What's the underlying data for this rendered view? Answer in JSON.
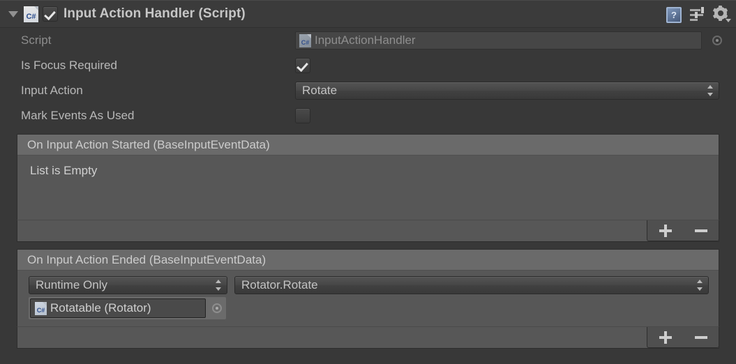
{
  "component": {
    "title": "Input Action Handler (Script)",
    "enabled": true,
    "foldout_expanded": true,
    "script_icon_label": "C#",
    "help_icon_glyph": "?",
    "icons": {
      "help": "help-book-icon",
      "preset": "preset-icon",
      "settings": "gear-dropdown-icon"
    }
  },
  "properties": {
    "script": {
      "label": "Script",
      "value": "InputActionHandler",
      "icon_label": "C#",
      "disabled": true
    },
    "is_focus_required": {
      "label": "Is Focus Required",
      "checked": true
    },
    "input_action": {
      "label": "Input Action",
      "value": "Rotate"
    },
    "mark_events_as_used": {
      "label": "Mark Events As Used",
      "checked": false
    }
  },
  "events": [
    {
      "header": "On Input Action Started (BaseInputEventData)",
      "empty_message": "List is Empty",
      "entries": []
    },
    {
      "header": "On Input Action Ended (BaseInputEventData)",
      "empty_message": "",
      "entries": [
        {
          "mode": "Runtime Only",
          "function": "Rotator.Rotate",
          "target_object": "Rotatable (Rotator)",
          "target_icon_label": "C#"
        }
      ]
    }
  ],
  "list_controls": {
    "add_label": "+",
    "remove_label": "−"
  },
  "colors": {
    "background": "#383838",
    "header": "#3b3b3b",
    "event_body": "#575757",
    "event_header": "#6a6a6a",
    "text": "#b8b8b8",
    "text_dim": "#8d8d8d",
    "accent_script_icon": "#2b4c8c"
  }
}
